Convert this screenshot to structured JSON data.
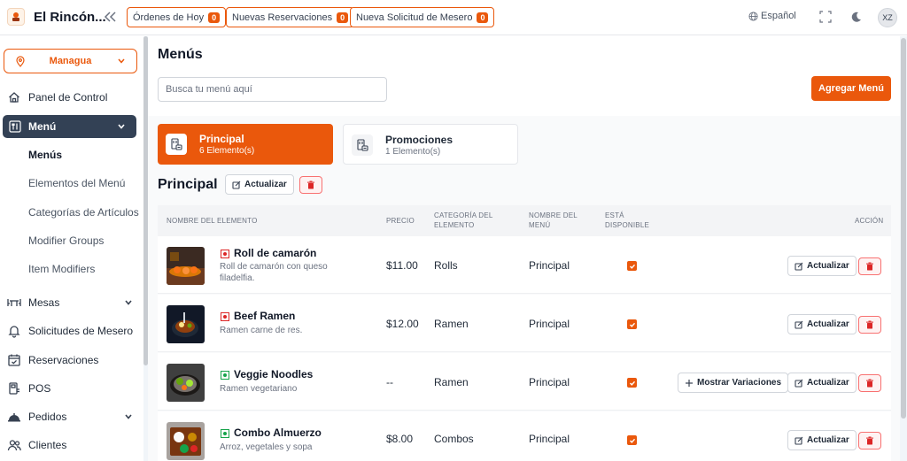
{
  "header": {
    "brand": "El Rincón...",
    "pills": [
      {
        "label": "Órdenes de Hoy",
        "count": "0"
      },
      {
        "label": "Nuevas Reservaciones",
        "count": "0"
      },
      {
        "label": "Nueva Solicitud de Mesero",
        "count": "0"
      }
    ],
    "language": "Español",
    "avatar_initials": "XZ"
  },
  "sidebar": {
    "branch": "Managua",
    "items": [
      {
        "label": "Panel de Control",
        "icon": "home-icon"
      },
      {
        "label": "Menú",
        "icon": "menu-book-icon",
        "active": true
      },
      {
        "label": "Mesas",
        "icon": "table-icon"
      },
      {
        "label": "Solicitudes de Mesero",
        "icon": "bell-icon"
      },
      {
        "label": "Reservaciones",
        "icon": "calendar-icon"
      },
      {
        "label": "POS",
        "icon": "pos-icon"
      },
      {
        "label": "Pedidos",
        "icon": "cloche-icon"
      },
      {
        "label": "Clientes",
        "icon": "users-icon"
      }
    ],
    "submenu": [
      "Menús",
      "Elementos del Menú",
      "Categorías de Artículos",
      "Modifier Groups",
      "Item Modifiers"
    ]
  },
  "main": {
    "title": "Menús",
    "search_placeholder": "Busca tu menú aquí",
    "add_button": "Agregar Menú",
    "menus": [
      {
        "name": "Principal",
        "count": "6 Elemento(s)"
      },
      {
        "name": "Promociones",
        "count": "1 Elemento(s)"
      }
    ],
    "section_title": "Principal",
    "update_label": "Actualizar",
    "variations_label": "Mostrar Variaciones",
    "table": {
      "headers": {
        "name": "NOMBRE DEL ELEMENTO",
        "price": "PRECIO",
        "category_1": "CATEGORÍA DEL",
        "category_2": "ELEMENTO",
        "menu_1": "NOMBRE DEL",
        "menu_2": "MENÚ",
        "available_1": "ESTÁ",
        "available_2": "DISPONIBLE",
        "action": "ACCIÓN"
      },
      "rows": [
        {
          "name": "Roll de camarón",
          "desc1": "Roll de camarón con queso",
          "desc2": "filadelfia.",
          "price": "$11.00",
          "category": "Rolls",
          "menu": "Principal",
          "veg": false,
          "available": true
        },
        {
          "name": "Beef Ramen",
          "desc1": "Ramen carne de res.",
          "desc2": "",
          "price": "$12.00",
          "category": "Ramen",
          "menu": "Principal",
          "veg": false,
          "available": true
        },
        {
          "name": "Veggie Noodles",
          "desc1": "Ramen vegetariano",
          "desc2": "",
          "price": "--",
          "category": "Ramen",
          "menu": "Principal",
          "veg": true,
          "available": true,
          "variations": true
        },
        {
          "name": "Combo Almuerzo",
          "desc1": "Arroz, vegetales y sopa",
          "desc2": "",
          "price": "$8.00",
          "category": "Combos",
          "menu": "Principal",
          "veg": true,
          "available": true
        }
      ]
    }
  },
  "colors": {
    "accent": "#ea580c",
    "sidebar_active": "#334155",
    "veg": "#16a34a",
    "nonveg": "#dc2626"
  }
}
